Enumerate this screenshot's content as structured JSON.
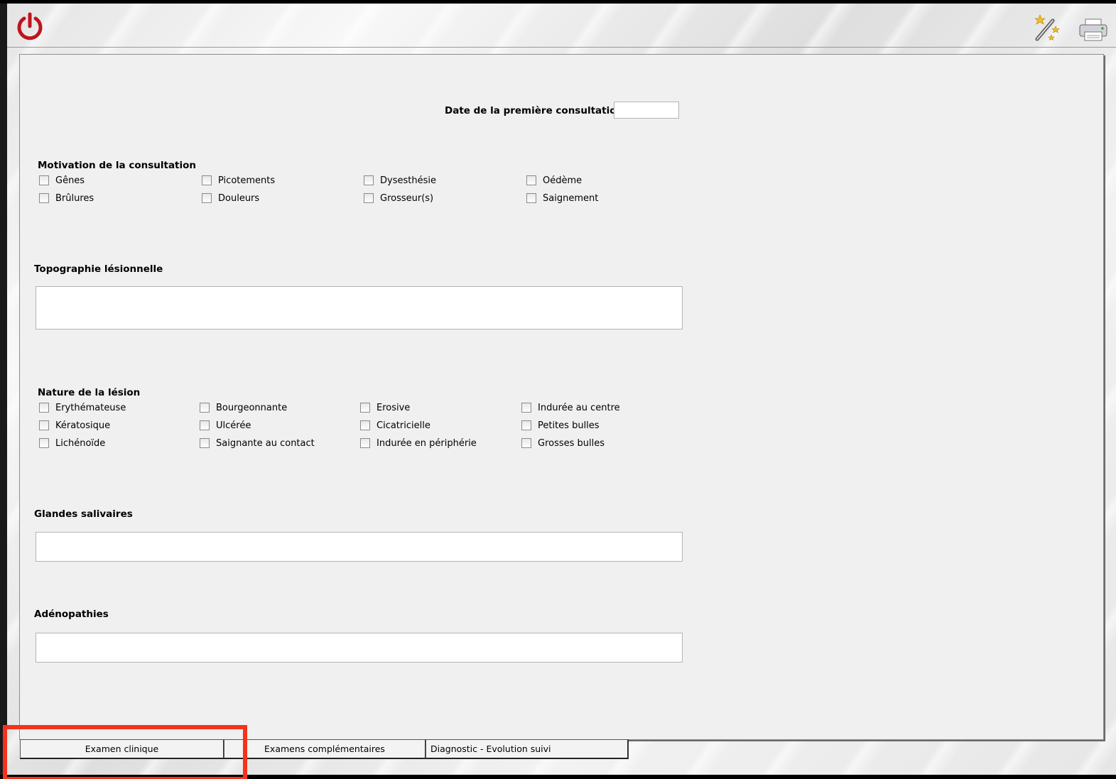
{
  "toolbar": {
    "power_icon": "power-icon",
    "wand_icon": "magic-wand-icon",
    "printer_icon": "printer-icon"
  },
  "form": {
    "first_consultation_label": "Date de la première consultation",
    "first_consultation_value": "",
    "motivation": {
      "title": "Motivation de la consultation",
      "options": [
        "Gênes",
        "Picotements",
        "Dysesthésie",
        "Oédème",
        "Brûlures",
        "Douleurs",
        "Grosseur(s)",
        "Saignement"
      ]
    },
    "topographie": {
      "title": "Topographie lésionnelle",
      "value": ""
    },
    "nature": {
      "title": "Nature de la lésion",
      "options": [
        "Erythémateuse",
        "Bourgeonnante",
        "Erosive",
        "Indurée au centre",
        "Kératosique",
        "Ulcérée",
        "Cicatricielle",
        "Petites bulles",
        "Lichénoïde",
        "Saignante au contact",
        "Indurée en périphérie",
        "Grosses bulles"
      ]
    },
    "glandes": {
      "title": "Glandes salivaires",
      "value": ""
    },
    "adenopathies": {
      "title": "Adénopathies",
      "value": ""
    }
  },
  "tabs": [
    "Examen clinique",
    "Examens complémentaires",
    "Diagnostic - Evolution suivi"
  ],
  "colors": {
    "highlight": "#f5321a",
    "panel": "#f0f0f0",
    "power": "#c0141c"
  }
}
